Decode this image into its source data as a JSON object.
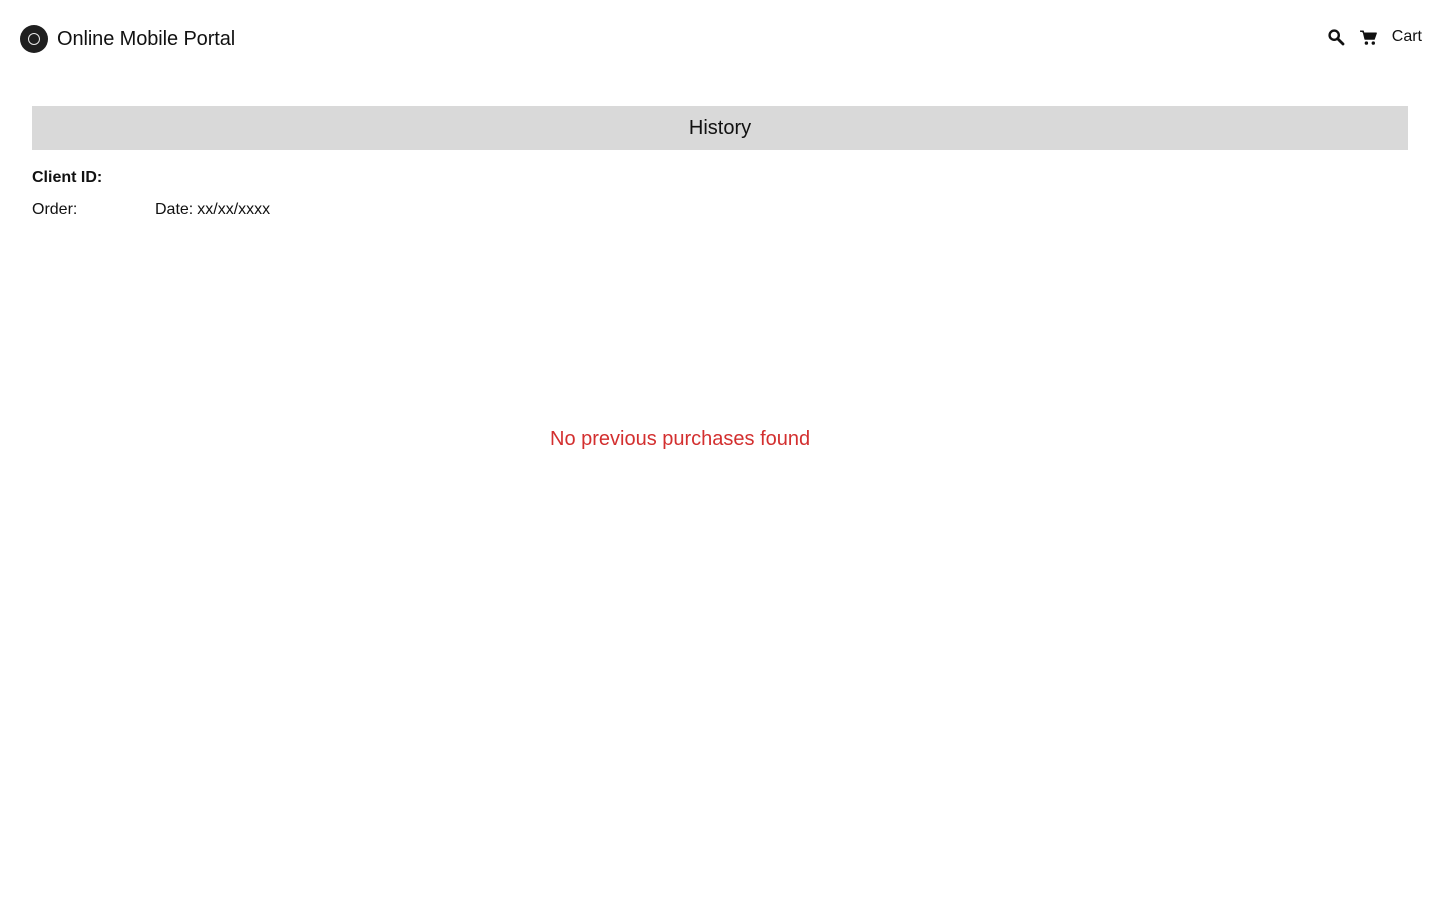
{
  "header": {
    "brand_title": "Online Mobile Portal",
    "cart_label": "Cart",
    "icons": {
      "logo": "circle-logo-icon",
      "search": "search-icon",
      "cart": "shopping-cart-icon"
    }
  },
  "history": {
    "title": "History",
    "client_id_label": "Client ID:",
    "order_label": "Order:",
    "date_label": "Date:",
    "date_value": "xx/xx/xxxx",
    "empty_message": "No previous purchases found"
  },
  "colors": {
    "header_background": "#d9d9d9",
    "empty_message": "#d32f2f",
    "logo_background": "#1f1f1f"
  }
}
